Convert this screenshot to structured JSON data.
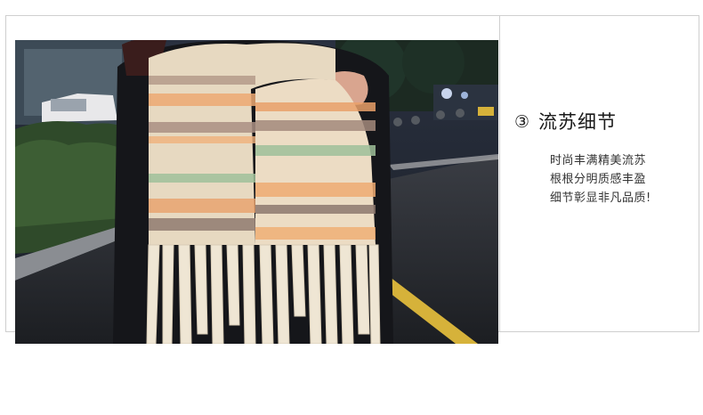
{
  "feature": {
    "number": "③",
    "title": "流苏细节",
    "description": [
      "时尚丰满精美流苏",
      "根根分明质感丰盈",
      "细节彰显非凡品质!"
    ]
  }
}
